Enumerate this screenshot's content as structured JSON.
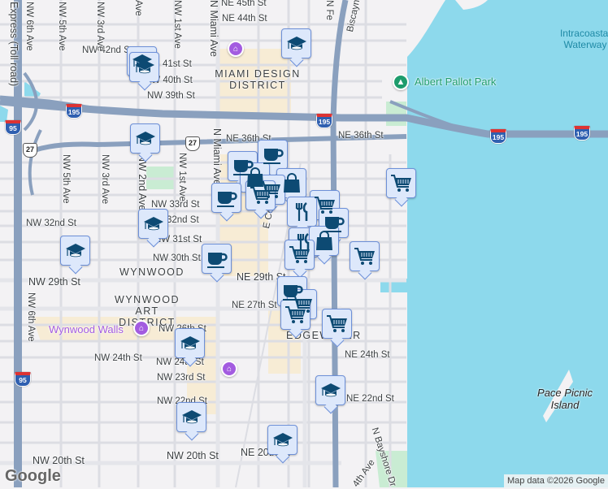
{
  "colors": {
    "water": "#8dd9ec",
    "land": "#f3f2f4",
    "highway": "#8aa0be",
    "marker_bg": "#dde8fb",
    "marker_icon": "#0d4a73",
    "museum": "#a35ce0",
    "park": "#1e9c6c"
  },
  "streets": {
    "ne45": "NE 45th St",
    "ne44": "NE 44th St",
    "nw42": "NW 42nd St",
    "nw41": "41st St",
    "nw40": "NW 40th St",
    "nw39": "NW 39th St",
    "ne36a": "NE 36th St",
    "ne36b": "NE 36th St",
    "nw33": "NW 33rd St",
    "nw32a": "NW 32nd St",
    "nw32b": "32nd St",
    "nw31": "NW 31st St",
    "nw30": "NW 30th St",
    "nw29": "NW 29th St",
    "ne29": "NE 29th St",
    "ne27": "NE 27th St",
    "nw26": "NW 26th St",
    "nw24a": "NW 24th St",
    "nw24b": "NW 24th St",
    "nw23": "NW 23rd St",
    "nw22": "NW 22nd St",
    "nw20a": "NW 20th St",
    "nw20b": "NW 20th St",
    "ne24": "NE 24th St",
    "ne22": "NE 22nd St",
    "ne20": "NE 20th St",
    "nw6a": "NW 6th Ave",
    "nw5a": "NW 5th Ave",
    "nw3a": "NW 3rd Ave",
    "nw2a": "Ave",
    "nw1a": "NW 1st Ave",
    "nmiamia": "N Miami Ave",
    "nw5b": "NW 5th Ave",
    "nw3b": "NW 3rd Ave",
    "nw2b": "NW 2nd Ave",
    "nw1b": "NW 1st Ave",
    "nmiamib": "N Miami Ave",
    "nw6b": "NW 6th Ave",
    "express": "Express (Toll road)",
    "ecoast": "E Coast Ave",
    "nfed": "N Fe",
    "biscayne": "Biscayne",
    "bayshore": "N Bayshore Dr",
    "ne4": "4th Ave"
  },
  "districts": {
    "design": "MIAMI DESIGN DISTRICT",
    "wynwood": "WYNWOOD",
    "art": "WYNWOOD ART DISTRICT",
    "edgewater": "EDGEWATER"
  },
  "pois": {
    "walls": "Wynwood Walls",
    "pallot": "Albert Pallot Park",
    "waterway": "Intracoastal Waterway",
    "pace": "Pace Picnic Island"
  },
  "shields": {
    "i195": "195",
    "i95": "95",
    "us27": "27"
  },
  "footer": {
    "logo": "Google",
    "attribution": "Map data ©2026 Google"
  }
}
